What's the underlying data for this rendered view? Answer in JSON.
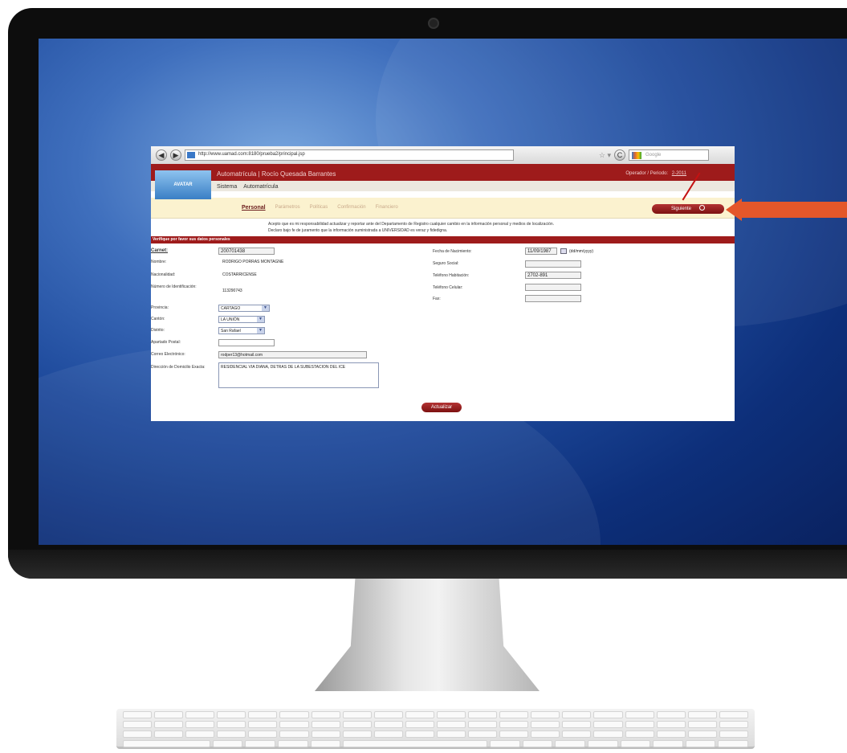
{
  "browser": {
    "url": "http://www.uamad.com:8180/prueba2/principal.jsp",
    "search_placeholder": "Google",
    "back_glyph": "◀",
    "forward_glyph": "▶",
    "reload_glyph": "C",
    "star_glyph": "☆ ▾"
  },
  "app": {
    "logo_text": "AVATAR",
    "title": "Automatrícula | Rocío Quesada Barrantes",
    "user_label": "Operador / Periodo",
    "period_link": "2-2011",
    "menu": [
      "Sistema",
      "Automatrícula"
    ]
  },
  "tabs": {
    "items": [
      "Personal",
      "Parámetros",
      "Políticas",
      "Confirmación",
      "Financiero"
    ],
    "active_index": 0
  },
  "next_button": "Siguiente",
  "notice": {
    "line1": "Acepto que es mi responsabilidad actualizar y reportar ante del Departamento de Registro cualquier cambio en la información personal y medios de localización.",
    "line2": "Declaro bajo fe de juramento que la información suministrada a UNIVERSIDAD es veraz y fidedigna."
  },
  "section_title": "Verifique por favor sus datos personales",
  "form": {
    "left": {
      "carnet_label": "Carnet:",
      "carnet_value": "200701438",
      "nombre_label": "Nombre:",
      "nombre_value": "RODRIGO PORRAS MONTAGNE",
      "nacionalidad_label": "Nacionalidad:",
      "nacionalidad_value": "COSTARRICENSE",
      "numero_label": "Número de Identificación:",
      "numero_value": "113290743",
      "provincia_label": "Provincia:",
      "provincia_value": "CARTAGO",
      "canton_label": "Cantón:",
      "canton_value": "LA UNIÓN",
      "distrito_label": "Distrito:",
      "distrito_value": "San Rafael",
      "apartado_label": "Apartado Postal:",
      "apartado_value": "",
      "correo_label": "Correo Electrónico:",
      "correo_value": "rodper13@hotmail.com",
      "direccion_label": "Dirección de Domicilio Exacta:",
      "direccion_value": "RESIDENCIAL VIA DIANA, DETRAS DE LA SUBESTACION DEL ICE"
    },
    "right": {
      "fecha_label": "Fecha de Nacimiento:",
      "fecha_value": "11/09/1987",
      "fecha_format": "(dd/mm/yyyy)",
      "seguro_label": "Seguro Social:",
      "seguro_value": "",
      "tel_hab_label": "Teléfono Habitación:",
      "tel_hab_value": "2702-891",
      "tel_cel_label": "Teléfono Celular:",
      "tel_cel_value": "",
      "fax_label": "Fax:",
      "fax_value": ""
    },
    "update_button": "Actualizar"
  },
  "colors": {
    "brand_red": "#9e1b1b",
    "callout_orange": "#e4572a",
    "tab_bar": "#fbf2cf"
  }
}
